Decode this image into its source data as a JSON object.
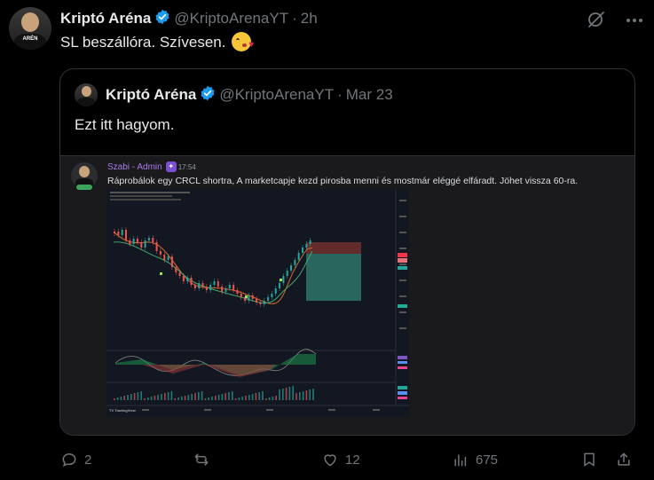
{
  "tweet": {
    "author_name": "Kriptó Aréna",
    "handle": "@KriptoArenaYT",
    "separator": "·",
    "time": "2h",
    "text": "SL beszállóra. Szívesen.",
    "avatar_shirt_text": "ARÉN",
    "emoji": "kissing-face-with-heart-emoji"
  },
  "quote": {
    "author_name": "Kriptó Aréna",
    "handle": "@KriptoArenaYT",
    "separator": "·",
    "time": "Mar 23",
    "text": "Ezt itt hagyom.",
    "discord": {
      "username": "Szabi - Admin",
      "time": "17:54",
      "message": "Ráprobálok egy CRCL shortra, A marketcapje kezd pirosba menni és mostmár eléggé elfáradt. Jöhet vissza 60-ra.",
      "username_color": "#a87be8"
    },
    "tradingview_logo": "TV TradingView"
  },
  "actions": {
    "replies": "2",
    "retweets": "",
    "likes": "12",
    "views": "675"
  },
  "colors": {
    "background": "#000000",
    "text": "#e7e9ea",
    "muted": "#71767b",
    "verified": "#1d9bf0",
    "border": "#2f3336"
  }
}
